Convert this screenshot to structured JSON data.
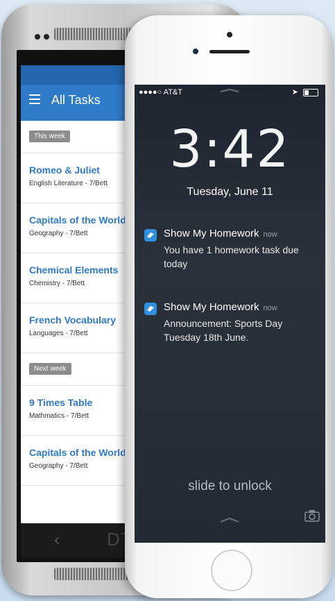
{
  "android": {
    "app_title": "All Tasks",
    "brand": "DTL",
    "sections": [
      {
        "label": "This week",
        "tasks": [
          {
            "title": "Romeo & Juliet",
            "subtitle": "English Literature - 7/Bett"
          },
          {
            "title": "Capitals of the World",
            "subtitle": "Geography - 7/Bett"
          },
          {
            "title": "Chemical Elements",
            "subtitle": "Chemistry - 7/Bett"
          },
          {
            "title": "French Vocabulary",
            "subtitle": "Languages - 7/Bett"
          }
        ]
      },
      {
        "label": "Next week",
        "tasks": [
          {
            "title": "9 Times Table",
            "subtitle": "Mathmatics - 7/Bett"
          },
          {
            "title": "Capitals of the World",
            "subtitle": "Geography - 7/Bett"
          }
        ]
      }
    ]
  },
  "iphone": {
    "carrier": "●●●●○ AT&T",
    "time": "3:42",
    "date": "Tuesday, June 11",
    "notifications": [
      {
        "app": "Show My Homework",
        "time": "now",
        "body": "You have 1 homework task due today"
      },
      {
        "app": "Show My Homework",
        "time": "now",
        "body": "Announcement: Sports Day Tuesday 18th June."
      }
    ],
    "slide_text": "slide to unlock"
  },
  "colors": {
    "accent": "#2f7ac9",
    "chip": "#8c8c8c",
    "lock_bg": "#242a33"
  }
}
